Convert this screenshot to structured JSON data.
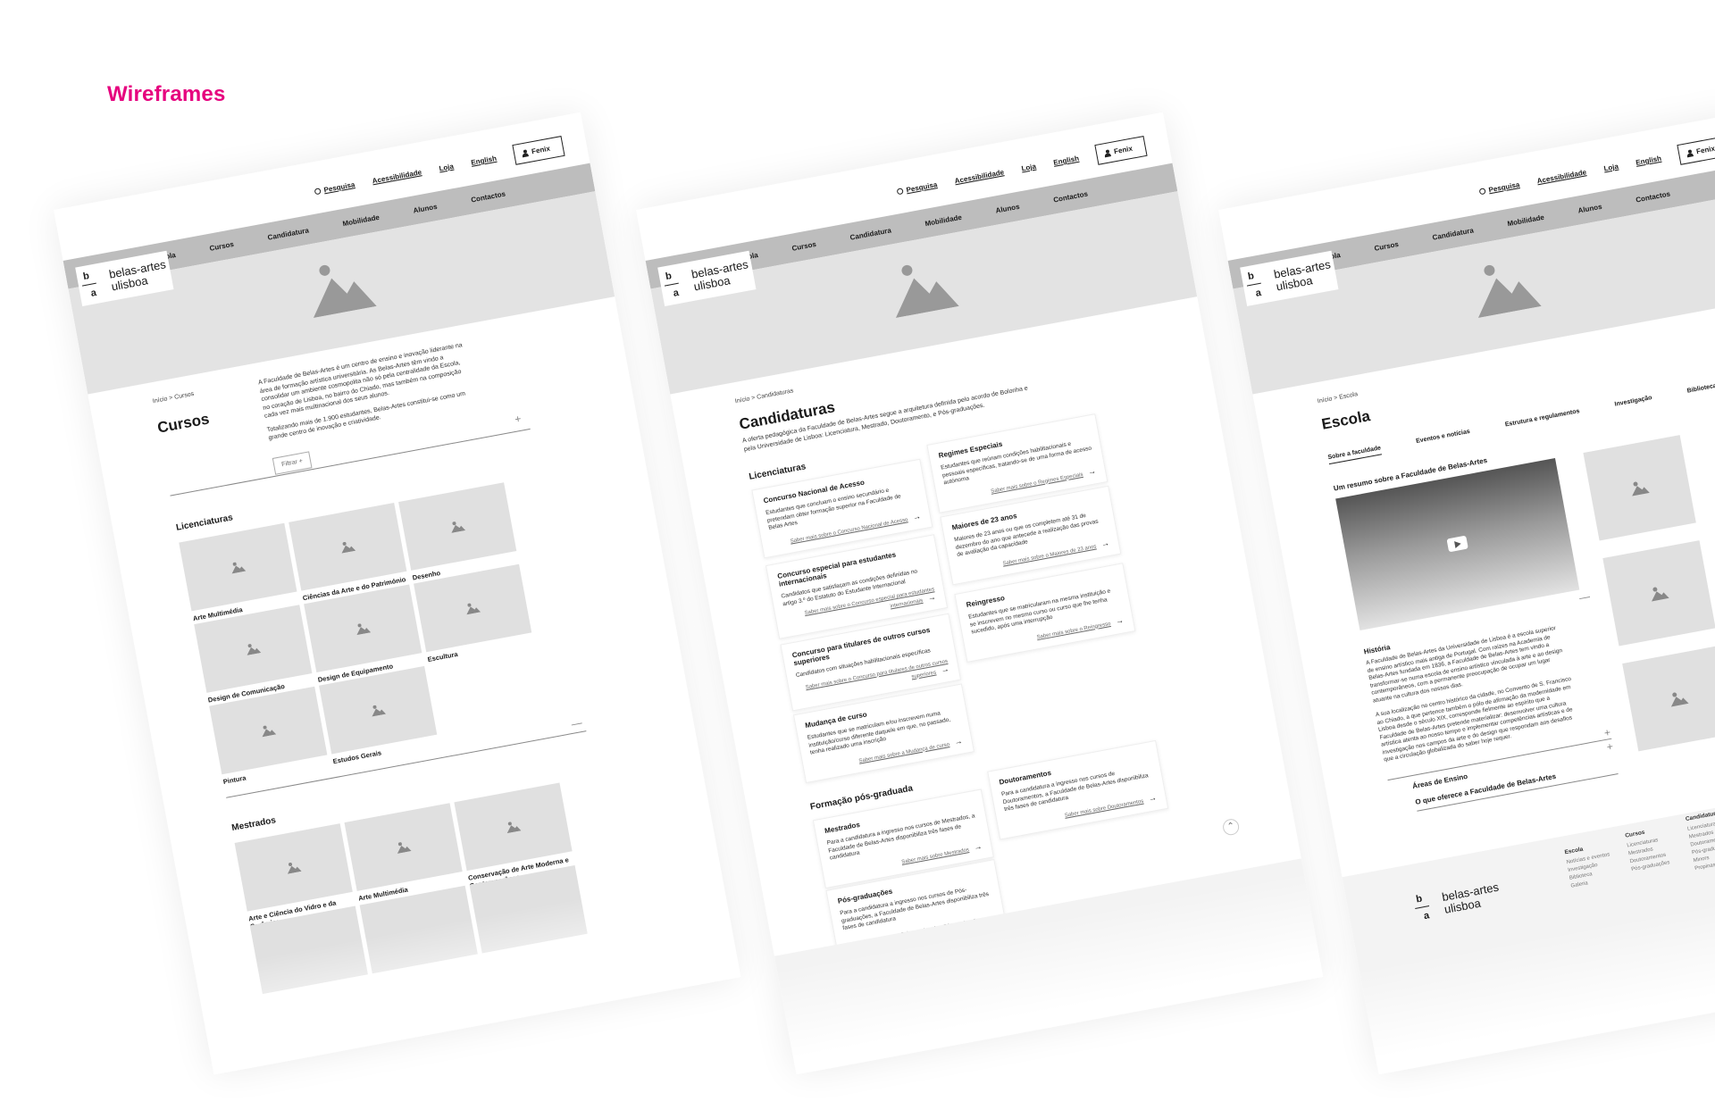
{
  "heading": "Wireframes",
  "common": {
    "utility": {
      "search": "Pesquisa",
      "accessibility": "Acessibilidade",
      "store": "Loja",
      "language": "English",
      "login": "Fenix"
    },
    "logo_line1": "belas-artes",
    "logo_line2": "ulisboa",
    "logo_b": "b",
    "logo_a": "a",
    "nav": [
      "Escola",
      "Cursos",
      "Candidatura",
      "Mobilidade",
      "Alunos",
      "Contactos"
    ],
    "breadcrumb_home": "Início",
    "breadcrumb_sep": ">"
  },
  "cursos": {
    "breadcrumb_current": "Cursos",
    "title": "Cursos",
    "intro_p1": "A Faculdade de Belas-Artes é um centro de ensino e inovação liderante na área de formação artística universitária. As Belas-Artes têm vindo a consolidar um ambiente cosmopolita não só pela centralidade da Escola, no coração de Lisboa, no bairro do Chiado, mas também na composição cada vez mais multinacional dos seus alunos.",
    "intro_p2": "Totalizando mais de 1.900 estudantes, Belas-Artes constitui-se como um grande centro de inovação e criatividade.",
    "filter": "Filtrar",
    "licenciaturas_title": "Licenciaturas",
    "licenciaturas": [
      "Arte Multimédia",
      "Ciências da Arte e do Património",
      "Desenho",
      "Design de Comunicação",
      "Design de Equipamento",
      "Escultura",
      "Pintura",
      "Estudos Gerais"
    ],
    "mestrados_title": "Mestrados",
    "mestrados": [
      "Arte e Ciência do Vidro e da Cerâmica",
      "Arte Multimédia",
      "Conservação de Arte Moderna e Contemporânea"
    ]
  },
  "candidaturas": {
    "breadcrumb_current": "Candidaturas",
    "title": "Candidaturas",
    "intro": "A oferta pedagógica da Faculdade de Belas-Artes segue a arquitetura definida pelo acordo de Bolonha e pela Universidade de Lisboa: Licenciatura, Mestrado, Doutoramento, e Pós-graduações.",
    "licenciaturas_title": "Licenciaturas",
    "cards": [
      {
        "title": "Concurso Nacional de Acesso",
        "desc": "Estudantes que concluam o ensino secundário e pretendam obter formação superior na Faculdade de Belas Artes",
        "link": "Saber mais sobre o Concurso Nacional de Acesso"
      },
      {
        "title": "Regimes Especiais",
        "desc": "Estudantes que reúnam condições habilitacionais e pessoais específicas, tratando-se de uma forma de acesso autónoma",
        "link": "Saber mais sobre o Regimes Especiais"
      },
      {
        "title": "Concurso especial para estudantes internacionais",
        "desc": "Candidatos que satisfaçam as condições definidas no artigo 3.º do Estatuto do Estudante Internacional",
        "link": "Saber mais sobre o Concurso especial para estudantes internacionais"
      },
      {
        "title": "Maiores de 23 anos",
        "desc": "Maiores de 23 anos ou que os completem até 31 de dezembro do ano que antecede a realização das provas de avaliação da capacidade",
        "link": "Saber mais sobre o Maiores de 23 anos"
      },
      {
        "title": "Concurso para titulares de outros cursos superiores",
        "desc": "Candidatos com situações habilitacionais específicas",
        "link": "Saber mais sobre o Concurso para titulares de outros cursos superiores"
      },
      {
        "title": "Reingresso",
        "desc": "Estudantes que se matricularam na mesma instituição e se inscrevem no mesmo curso ou curso que lhe tenha sucedido, após uma interrupção",
        "link": "Saber mais sobre o Reingresso"
      },
      {
        "title": "Mudança de curso",
        "desc": "Estudantes que se matriculam e/ou inscrevem numa instituição/curso diferente daquele em que, no passado, tenha realizado uma inscrição",
        "link": "Saber mais sobre a Mudança de curso"
      }
    ],
    "pos_title": "Formação pós-graduada",
    "pos_cards": [
      {
        "title": "Mestrados",
        "desc": "Para a candidatura a ingresso nos cursos de Mestrados, a Faculdade de Belas-Artes disponibiliza três fases de candidatura",
        "link": "Saber mais sobre Mestrados"
      },
      {
        "title": "Doutoramentos",
        "desc": "Para a candidatura a ingresso nos cursos de Doutoramentos, a Faculdade de Belas-Artes disponibiliza três fases de candidatura",
        "link": "Saber mais sobre Doutoramentos"
      },
      {
        "title": "Pós-graduações",
        "desc": "Para a candidatura a ingresso nos cursos de Pós-graduações, a Faculdade de Belas-Artes disponibiliza três fases de candidatura",
        "link": "Saber mais sobre Pós-graduações"
      }
    ],
    "up_icon": "chevron-up-icon"
  },
  "escola": {
    "breadcrumb_current": "Escola",
    "title": "Escola",
    "tabs": [
      "Sobre a faculdade",
      "Eventos e notícias",
      "Estrutura e regulamentos",
      "Investigação",
      "Bibliotecas"
    ],
    "video_title": "Um resumo sobre a Faculdade de Belas-Artes",
    "historia_title": "História",
    "historia_p1": "A Faculdade de Belas-Artes da Universidade de Lisboa é a escola superior de ensino artístico mais antiga de Portugal. Com raízes na Academia de Belas-Artes fundada em 1836, a Faculdade de Belas-Artes tem vindo a transformar-se numa escola de ensino artístico vinculada à arte e ao design contemporâneos, com a permanente preocupação de ocupar um lugar atuante na cultura dos nossos dias.",
    "historia_p2": "A sua localização no centro histórico da cidade, no Convento de S. Francisco ao Chiado, a que pertence também o pólo de afirmação da modernidade em Lisboa desde o século XIX, corresponde fielmente ao espírito que a Faculdade de Belas-Artes pretende materializar: desenvolver uma cultura artística atenta ao nosso tempo e implementar competências artísticas e de investigação nos campos da arte e do design que respondam aos desafios que a circulação globalizada do saber hoje requer.",
    "areas": "Áreas de Ensino",
    "oferece": "O que oferece a Faculdade de Belas-Artes",
    "footer": {
      "escola": {
        "title": "Escola",
        "items": [
          "Notícias e eventos",
          "Investigação",
          "Biblioteca",
          "Galeria"
        ]
      },
      "cursos": {
        "title": "Cursos",
        "items": [
          "Licenciaturas",
          "Mestrados",
          "Doutoramentos",
          "Pós-graduações"
        ]
      },
      "candidatura": {
        "title": "Candidatura",
        "items": [
          "Licenciaturas",
          "Mestrados",
          "Doutoramentos",
          "Pós-graduações",
          "Minors",
          "Propinas"
        ]
      }
    }
  }
}
